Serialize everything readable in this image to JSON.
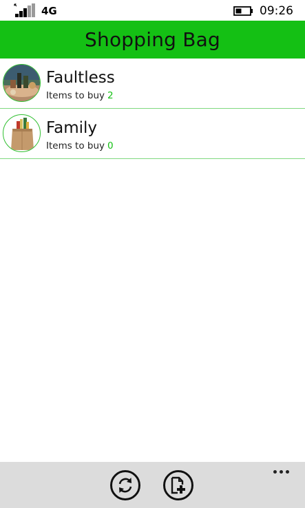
{
  "status_bar": {
    "network": "4G",
    "time": "09:26",
    "signal_icon": "signal-bars-icon",
    "battery_icon": "battery-icon"
  },
  "header": {
    "title": "Shopping Bag",
    "color": "#14c014"
  },
  "lists": [
    {
      "name": "Faultless",
      "sub_label": "Items to buy",
      "count": "2",
      "avatar": "photo-thumbnail"
    },
    {
      "name": "Family",
      "sub_label": "Items to buy",
      "count": "0",
      "avatar": "paper-bag-icon"
    }
  ],
  "app_bar": {
    "buttons": [
      {
        "icon": "sync-icon"
      },
      {
        "icon": "add-document-icon"
      }
    ],
    "more_icon": "ellipsis-icon"
  }
}
